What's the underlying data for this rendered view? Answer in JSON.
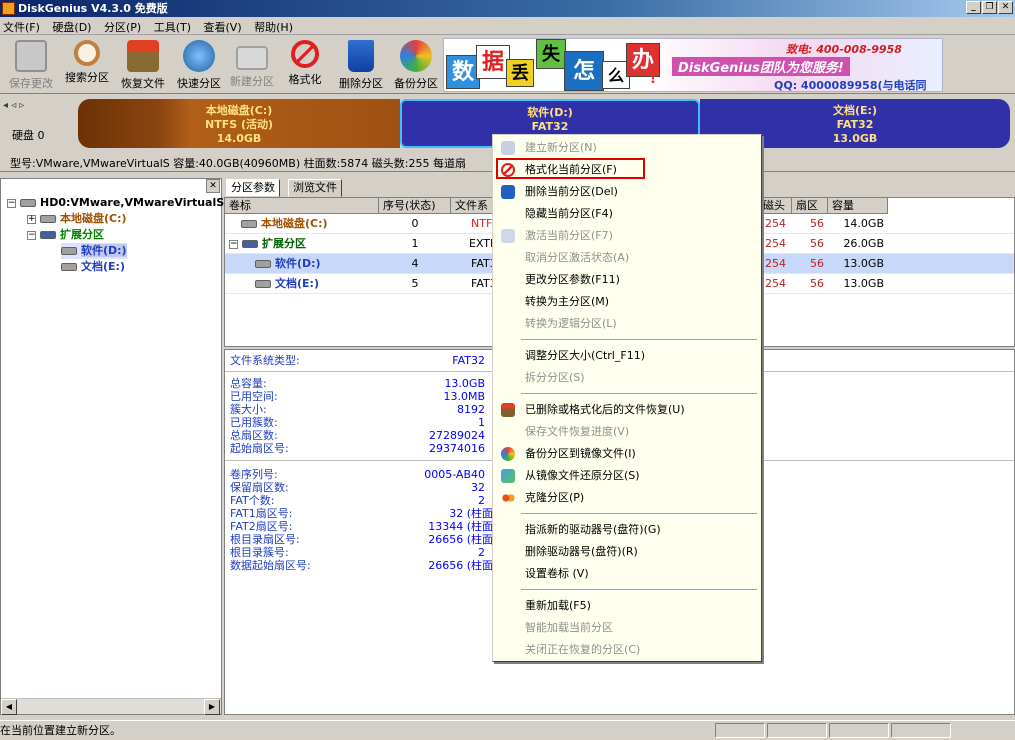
{
  "window": {
    "title": "DiskGenius V4.3.0 免费版",
    "min": "_",
    "restore": "❐",
    "close": "✕"
  },
  "menu": [
    "文件(F)",
    "硬盘(D)",
    "分区(P)",
    "工具(T)",
    "查看(V)",
    "帮助(H)"
  ],
  "toolbar": [
    {
      "label": "保存更改",
      "icon": "save-icon",
      "color": "#a0a0a0",
      "enabled": false
    },
    {
      "label": "搜索分区",
      "icon": "magnifier-icon",
      "color": "#c08040",
      "enabled": true
    },
    {
      "label": "恢复文件",
      "icon": "recover-box-icon",
      "color": "#806030",
      "enabled": true
    },
    {
      "label": "快速分区",
      "icon": "quick-partition-icon",
      "color": "#3080c0",
      "enabled": true
    },
    {
      "label": "新建分区",
      "icon": "new-partition-icon",
      "color": "#b0b0b0",
      "enabled": false
    },
    {
      "label": "格式化",
      "icon": "format-icon",
      "color": "#e02020",
      "enabled": true
    },
    {
      "label": "删除分区",
      "icon": "delete-bin-icon",
      "color": "#2060c0",
      "enabled": true
    },
    {
      "label": "备份分区",
      "icon": "backup-icon",
      "color": "#e08020",
      "enabled": true
    }
  ],
  "banner": {
    "chars": [
      "数",
      "据",
      "丢",
      "失",
      "怎",
      "么",
      "办",
      "!"
    ],
    "team": "DiskGenius团队为您服务!",
    "phone": "致电: 400-008-9958",
    "qq": "QQ: 4000089958(与电话同号)"
  },
  "disk": {
    "label": "硬盘 0",
    "partitions": [
      {
        "name": "本地磁盘(C:)",
        "fs": "NTFS (活动)",
        "size": "14.0GB"
      },
      {
        "name": "软件(D:)",
        "fs": "FAT32",
        "size": "14.0GB"
      },
      {
        "name": "文档(E:)",
        "fs": "FAT32",
        "size": "13.0GB"
      }
    ],
    "info": "型号:VMware,VMwareVirtualS  容量:40.0GB(40960MB)  柱面数:5874  磁头数:255  每道扇"
  },
  "tree": {
    "root": "HD0:VMware,VMwareVirtualS",
    "c": "本地磁盘(C:)",
    "ext": "扩展分区",
    "d": "软件(D:)",
    "e": "文档(E:)"
  },
  "tabs": [
    "分区参数",
    "浏览文件"
  ],
  "grid": {
    "headers": [
      "卷标",
      "序号(状态)",
      "文件系",
      "磁头",
      "扇区",
      "容量"
    ],
    "rows": [
      {
        "name": "本地磁盘(C:)",
        "num": "0",
        "fs": "NTF",
        "head": "254",
        "sec": "56",
        "size": "14.0GB"
      },
      {
        "name": "扩展分区",
        "num": "1",
        "fs": "EXTE",
        "head": "254",
        "sec": "56",
        "size": "26.0GB"
      },
      {
        "name": "软件(D:)",
        "num": "4",
        "fs": "FAT3",
        "head": "254",
        "sec": "56",
        "size": "13.0GB"
      },
      {
        "name": "文档(E:)",
        "num": "5",
        "fs": "FAT3",
        "head": "254",
        "sec": "56",
        "size": "13.0GB"
      }
    ]
  },
  "details": {
    "fs_label": "文件系统类型:",
    "fs_value": "FAT32",
    "group1": [
      [
        "总容量:",
        "13.0GB"
      ],
      [
        "已用空间:",
        "13.0MB"
      ],
      [
        "簇大小:",
        "8192"
      ],
      [
        "已用簇数:",
        "1"
      ],
      [
        "总扇区数:",
        "27289024"
      ],
      [
        "起始扇区号:",
        "29374016"
      ]
    ],
    "group2": [
      [
        "卷序列号:",
        "0005-AB40"
      ],
      [
        "保留扇区数:",
        "32"
      ],
      [
        "FAT个数:",
        "2"
      ],
      [
        "FAT1扇区号:",
        "32 (柱面"
      ],
      [
        "FAT2扇区号:",
        "13344 (柱面"
      ],
      [
        "根目录扇区号:",
        "26656 (柱面"
      ],
      [
        "根目录簇号:",
        "2"
      ],
      [
        "数据起始扇区号:",
        "26656 (柱面"
      ]
    ]
  },
  "context_menu": [
    {
      "label": "建立新分区(N)",
      "enabled": false,
      "icon": "new-partition-icon"
    },
    {
      "label": "格式化当前分区(F)",
      "enabled": true,
      "icon": "format-icon"
    },
    {
      "label": "删除当前分区(Del)",
      "enabled": true,
      "icon": "delete-bin-icon"
    },
    {
      "label": "隐藏当前分区(F4)",
      "enabled": true,
      "icon": ""
    },
    {
      "label": "激活当前分区(F7)",
      "enabled": false,
      "icon": "activate-icon"
    },
    {
      "label": "取消分区激活状态(A)",
      "enabled": false,
      "icon": ""
    },
    {
      "label": "更改分区参数(F11)",
      "enabled": true,
      "icon": ""
    },
    {
      "label": "转换为主分区(M)",
      "enabled": true,
      "icon": ""
    },
    {
      "label": "转换为逻辑分区(L)",
      "enabled": false,
      "icon": ""
    },
    {
      "sep": true
    },
    {
      "label": "调整分区大小(Ctrl_F11)",
      "enabled": true,
      "icon": ""
    },
    {
      "label": "拆分分区(S)",
      "enabled": false,
      "icon": ""
    },
    {
      "sep": true
    },
    {
      "label": "已删除或格式化后的文件恢复(U)",
      "enabled": true,
      "icon": "recover-box-icon"
    },
    {
      "label": "保存文件恢复进度(V)",
      "enabled": false,
      "icon": ""
    },
    {
      "label": "备份分区到镜像文件(I)",
      "enabled": true,
      "icon": "backup-icon"
    },
    {
      "label": "从镜像文件还原分区(S)",
      "enabled": true,
      "icon": "restore-icon"
    },
    {
      "label": "克隆分区(P)",
      "enabled": true,
      "icon": "clone-icon"
    },
    {
      "sep": true
    },
    {
      "label": "指派新的驱动器号(盘符)(G)",
      "enabled": true,
      "icon": ""
    },
    {
      "label": "删除驱动器号(盘符)(R)",
      "enabled": true,
      "icon": ""
    },
    {
      "label": "设置卷标 (V)",
      "enabled": true,
      "icon": ""
    },
    {
      "sep": true
    },
    {
      "label": "重新加载(F5)",
      "enabled": true,
      "icon": ""
    },
    {
      "label": "智能加载当前分区",
      "enabled": false,
      "icon": ""
    },
    {
      "label": "关闭正在恢复的分区(C)",
      "enabled": false,
      "icon": ""
    }
  ],
  "status": "在当前位置建立新分区。"
}
